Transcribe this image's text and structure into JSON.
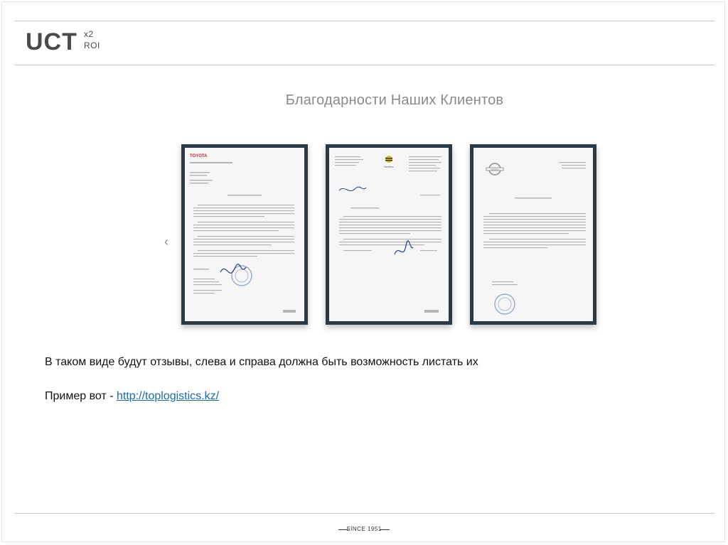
{
  "header": {
    "logo_main": "UCT",
    "logo_sup": "x2",
    "logo_sub": "ROI"
  },
  "slider": {
    "title": "Благодарности Наших Клиентов",
    "prev_arrow": "‹",
    "letters": [
      {
        "brand": "TOYOTA",
        "brand_color": "#c8202a"
      },
      {
        "brand": "Beeline",
        "brand_color": "#e6b91e"
      },
      {
        "brand": "NISSAN",
        "brand_color": "#777777"
      }
    ]
  },
  "body": {
    "caption": "В таком виде будут отзывы, слева и справа должна быть возможность листать их",
    "example_prefix": "Пример вот - ",
    "example_link": "http://toplogistics.kz/"
  },
  "footer": {
    "since": "SINCE 1951"
  },
  "colors": {
    "frame": "#2c3a45",
    "link": "#1a6aa4",
    "title": "#8a8a8a"
  }
}
